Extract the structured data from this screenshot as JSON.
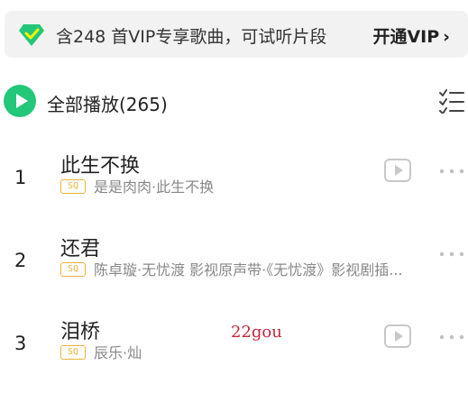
{
  "vip_banner": {
    "icon": "green-diamond-icon",
    "text": "含248 首VIP专享歌曲，可试听片段",
    "cta_label": "开通VIP",
    "cta_chevron": "›",
    "accent_color": "#22c779"
  },
  "playall": {
    "label": "全部播放(265)",
    "icon": "play-circle-icon",
    "right_icon": "multi-select-list-icon"
  },
  "songs": [
    {
      "index": "1",
      "title": "此生不换",
      "quality_badge": "SQ",
      "meta": "是是肉肉·此生不换",
      "has_mv": true
    },
    {
      "index": "2",
      "title": "还君",
      "quality_badge": "SQ",
      "meta": "陈卓璇·无忧渡 影视原声带·《无忧渡》影视剧插...",
      "has_mv": false
    },
    {
      "index": "3",
      "title": "泪桥",
      "quality_badge": "SQ",
      "meta": "辰乐·灿",
      "has_mv": true
    }
  ],
  "watermark": "22gou",
  "colors": {
    "badge": "#e8b23a",
    "meta_text": "#888888",
    "watermark": "#c2263a"
  }
}
